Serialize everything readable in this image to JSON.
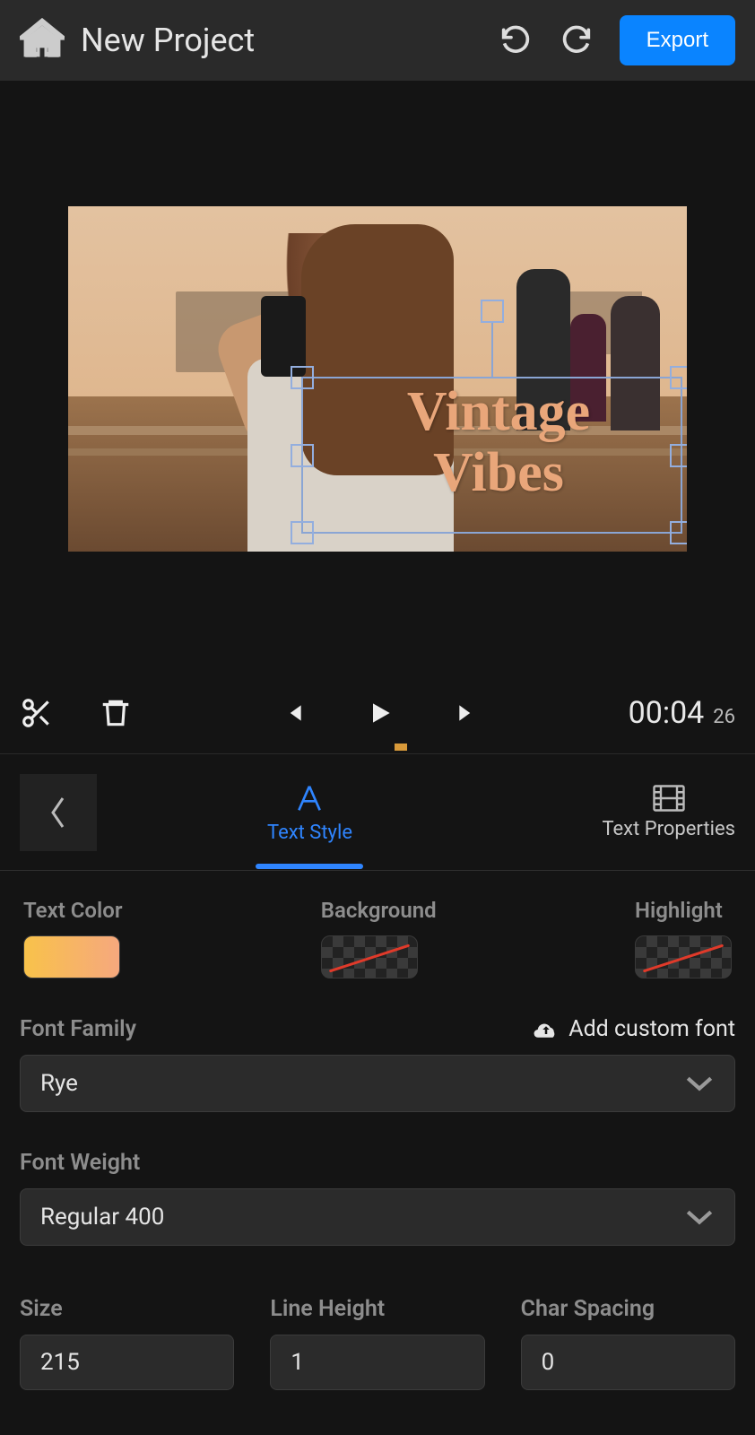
{
  "header": {
    "title": "New Project",
    "export_label": "Export"
  },
  "preview": {
    "overlay_text": "Vintage\nVibes"
  },
  "playback": {
    "time": "00:04",
    "frames": "26"
  },
  "tabs": {
    "style_label": "Text Style",
    "properties_label": "Text Properties"
  },
  "panel": {
    "text_color_label": "Text Color",
    "background_label": "Background",
    "highlight_label": "Highlight",
    "font_family_label": "Font Family",
    "add_custom_font_label": "Add custom font",
    "font_family_value": "Rye",
    "font_weight_label": "Font Weight",
    "font_weight_value": "Regular 400",
    "size_label": "Size",
    "size_value": "215",
    "line_height_label": "Line Height",
    "line_height_value": "1",
    "char_spacing_label": "Char Spacing",
    "char_spacing_value": "0",
    "text_color_swatch": "linear-gradient(90deg,#f8c24a,#f6a87e)"
  },
  "colors": {
    "accent": "#0a84ff"
  }
}
